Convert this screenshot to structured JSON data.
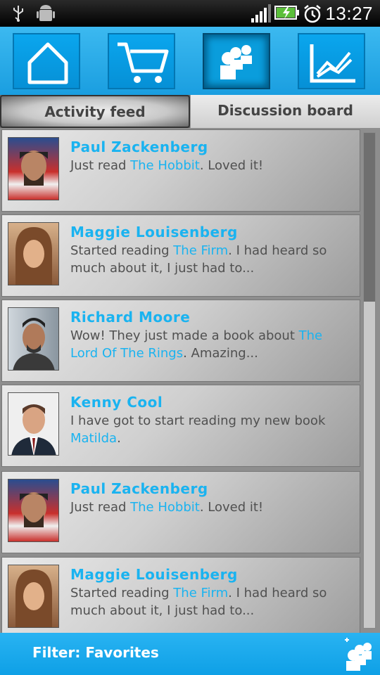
{
  "status_bar": {
    "time": "13:27"
  },
  "nav": {
    "items": [
      {
        "name": "home",
        "icon": "home-icon"
      },
      {
        "name": "cart",
        "icon": "cart-icon"
      },
      {
        "name": "community",
        "icon": "people-icon"
      },
      {
        "name": "stats",
        "icon": "chart-icon"
      }
    ],
    "active": "community"
  },
  "tabs": {
    "activity": "Activity feed",
    "discussion": "Discussion board"
  },
  "posts": [
    {
      "author": "Paul Zackenberg",
      "pre": "Just read ",
      "book": "The Hobbit",
      "post": ". Loved it!"
    },
    {
      "author": "Maggie Louisenberg",
      "pre": "Started reading ",
      "book": "The Firm",
      "post": ". I had heard so much about it, I just had to..."
    },
    {
      "author": "Richard Moore",
      "pre": "Wow! They just made a book about ",
      "book": "The Lord Of The Rings",
      "post": ". Amazing..."
    },
    {
      "author": "Kenny Cool",
      "pre": "I have got to start reading my new book ",
      "book": "Matilda",
      "post": "."
    },
    {
      "author": "Paul Zackenberg",
      "pre": "Just read ",
      "book": "The Hobbit",
      "post": ". Loved it!"
    },
    {
      "author": "Maggie Louisenberg",
      "pre": "Started reading ",
      "book": "The Firm",
      "post": ". I had heard so much about it, I just had to..."
    }
  ],
  "bottom": {
    "filter": "Filter: Favorites"
  },
  "colors": {
    "accent": "#1ab3f0",
    "nav_bg": "#3cb9f0",
    "text": "#505050"
  }
}
